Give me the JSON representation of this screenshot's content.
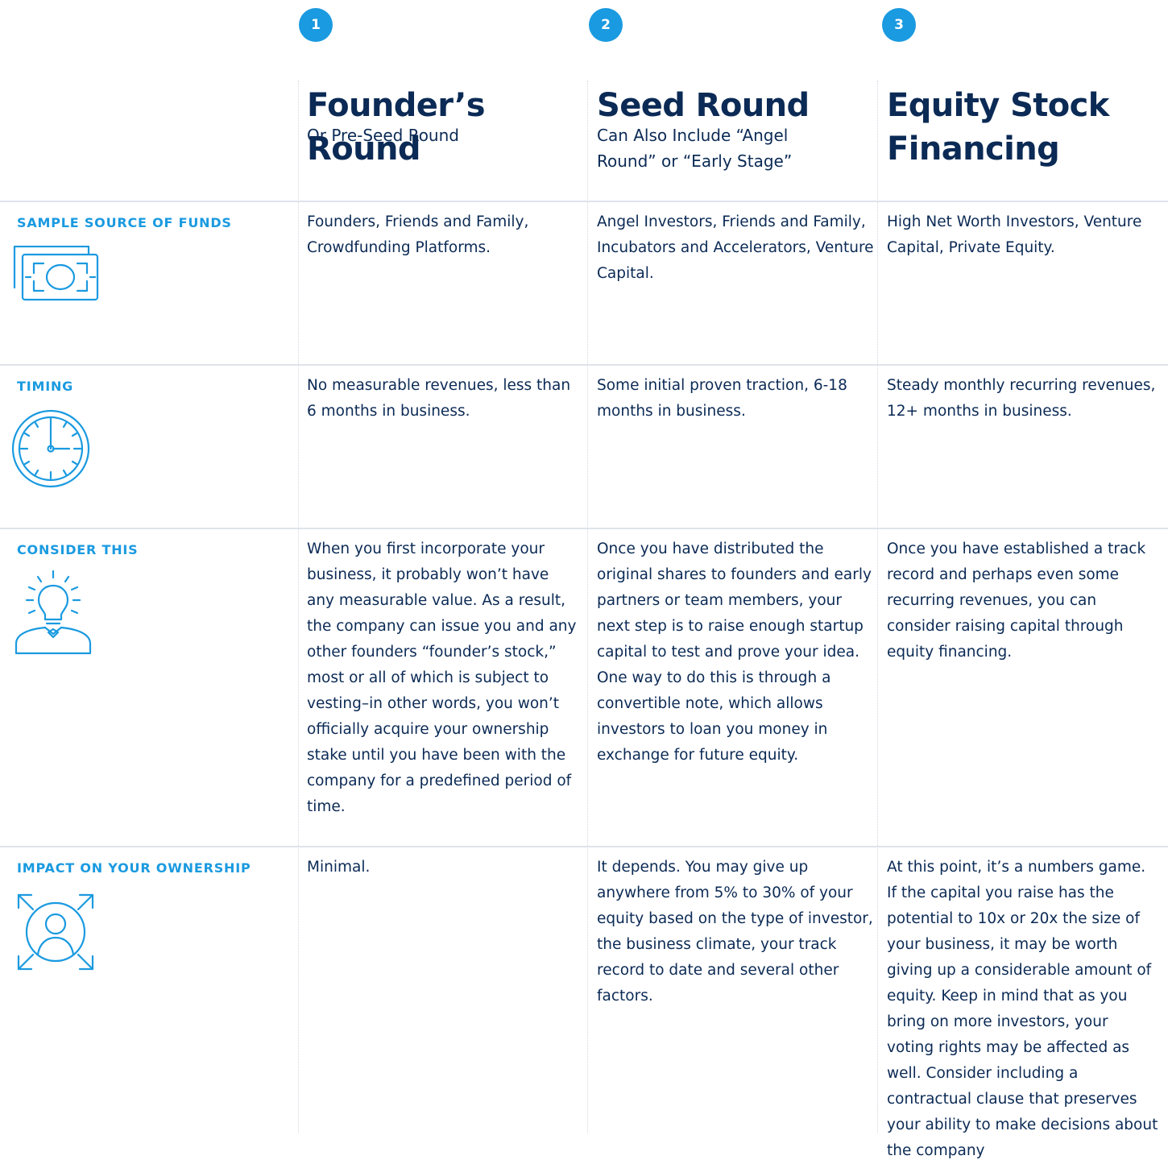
{
  "columns": [
    {
      "number": "1",
      "title": "Founder’s Round",
      "subtitle": "Or Pre-Seed Round"
    },
    {
      "number": "2",
      "title": "Seed Round",
      "subtitle": "Can Also Include “Angel Round” or “Early Stage”"
    },
    {
      "number": "3",
      "title": "Equity Stock Financing",
      "subtitle": ""
    }
  ],
  "rows": [
    {
      "label": "SAMPLE SOURCE OF FUNDS",
      "icon": "money-icon",
      "cells": [
        "Founders, Friends and Family, Crowdfunding Platforms.",
        "Angel Investors, Friends and Family, Incubators and Accelerators, Venture Capital.",
        "High Net Worth Investors, Venture Capital, Private Equity."
      ]
    },
    {
      "label": "TIMING",
      "icon": "clock-icon",
      "cells": [
        "No measurable revenues, less than 6 months in business.",
        "Some initial proven traction, 6-18 months in business.",
        "Steady monthly recurring revenues, 12+ months in business."
      ]
    },
    {
      "label": "CONSIDER THIS",
      "icon": "lightbulb-person-icon",
      "cells": [
        "When you first incorporate your business, it probably won’t have any measurable value. As a result, the company can issue you and any other founders “founder’s stock,” most or all of which is subject to vesting–in other words, you won’t officially acquire your ownership stake until you have been with the company for a predefined period of time.",
        "Once you have distributed the original shares to founders and early partners or team members, your next step is to raise enough startup capital to test and prove your idea. One way to do this is through a convertible note, which allows investors to loan you money in exchange for future equity.",
        "Once you have established a track record and perhaps even some recurring revenues, you can consider raising capital through equity financing."
      ]
    },
    {
      "label": "IMPACT ON YOUR OWNERSHIP",
      "icon": "person-expand-icon",
      "cells": [
        "Minimal.",
        "It depends. You may give up anywhere from 5% to 30% of your equity based on the type of investor, the business climate, your track record to date and several other factors.",
        "At this point, it’s a numbers game. If the capital you raise has the potential to 10x or 20x the size of your business, it may be worth giving up a considerable amount of equity. Keep in mind that as you bring on more investors, your voting rights may be affected as well. Consider including a contractual clause that preserves your ability to make decisions about the company"
      ]
    }
  ],
  "colors": {
    "accent": "#1a9ae0",
    "navy": "#0b2a55",
    "divider": "#dfe3ea"
  }
}
